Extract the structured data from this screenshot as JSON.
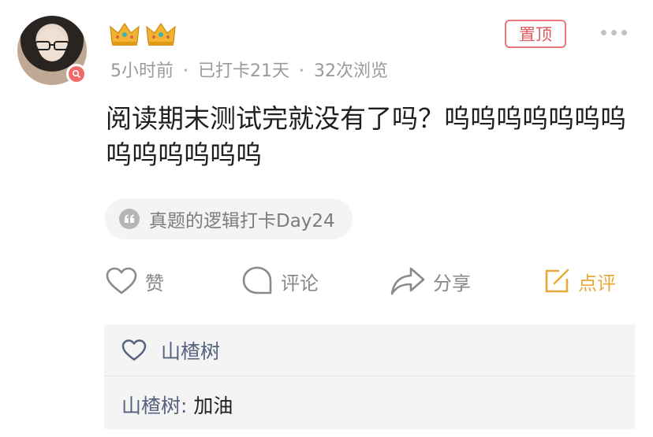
{
  "post": {
    "meta": {
      "time_ago": "5小时前",
      "checkin_days": "已打卡21天",
      "views": "32次浏览",
      "separator": "·"
    },
    "pin_label": "置顶",
    "content": "阅读期末测试完就没有了吗？呜呜呜呜呜呜呜呜呜呜呜呜呜",
    "topic_tag": "真题的逻辑打卡Day24"
  },
  "actions": {
    "like_label": "赞",
    "comment_label": "评论",
    "share_label": "分享",
    "review_label": "点评"
  },
  "likes": {
    "liker_name": "山楂树"
  },
  "comments": [
    {
      "author": "山楂树",
      "separator": ":",
      "text": " 加油"
    }
  ],
  "colors": {
    "pin_border": "#e8767a",
    "accent_orange": "#e8a93a",
    "link_blue_gray": "#56627e",
    "meta_gray": "#9a9a9a"
  },
  "icons": [
    "crown-icon",
    "more-icon",
    "quote-icon",
    "heart-icon",
    "comment-icon",
    "share-icon",
    "edit-icon"
  ]
}
